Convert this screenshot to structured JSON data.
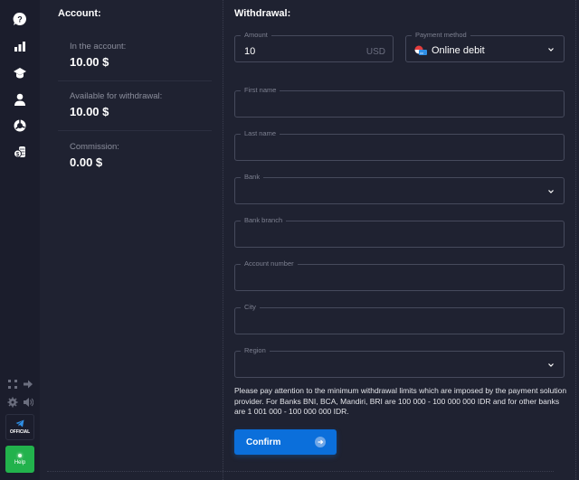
{
  "sidebar": {
    "icons": [
      "help-icon",
      "chart-bars-icon",
      "education-icon",
      "user-icon",
      "pie-chart-icon",
      "coins-icon"
    ],
    "bottom_icons": [
      "fullscreen-icon",
      "logout-arrow-icon",
      "settings-gear-icon",
      "sound-icon"
    ],
    "official_label": "OFFICIAL",
    "help_label": "Help"
  },
  "account": {
    "title": "Account:",
    "rows": [
      {
        "label": "In the account:",
        "value": "10.00 $"
      },
      {
        "label": "Available for withdrawal:",
        "value": "10.00 $"
      },
      {
        "label": "Commission:",
        "value": "0.00 $"
      }
    ]
  },
  "withdrawal": {
    "title": "Withdrawal:",
    "amount": {
      "label": "Amount",
      "value": "10",
      "currency": "USD"
    },
    "payment_method": {
      "label": "Payment method",
      "value": "Online debit"
    },
    "fields": {
      "first_name": {
        "label": "First name",
        "value": ""
      },
      "last_name": {
        "label": "Last name",
        "value": ""
      },
      "bank": {
        "label": "Bank",
        "value": ""
      },
      "bank_branch": {
        "label": "Bank branch",
        "value": ""
      },
      "account_number": {
        "label": "Account number",
        "value": ""
      },
      "city": {
        "label": "City",
        "value": ""
      },
      "region": {
        "label": "Region",
        "value": ""
      }
    },
    "notice": "Please pay attention to the minimum withdrawal limits which are imposed by the payment solution provider. For Banks BNI, BCA, Mandiri, BRI are 100 000 - 100 000 000 IDR and for other banks are 1 001 000 - 100 000 000 IDR.",
    "confirm_label": "Confirm"
  },
  "colors": {
    "background": "#1f2231",
    "sidebar": "#1b1d2c",
    "accent_blue": "#0b6fdb",
    "help_green": "#22b24c"
  }
}
